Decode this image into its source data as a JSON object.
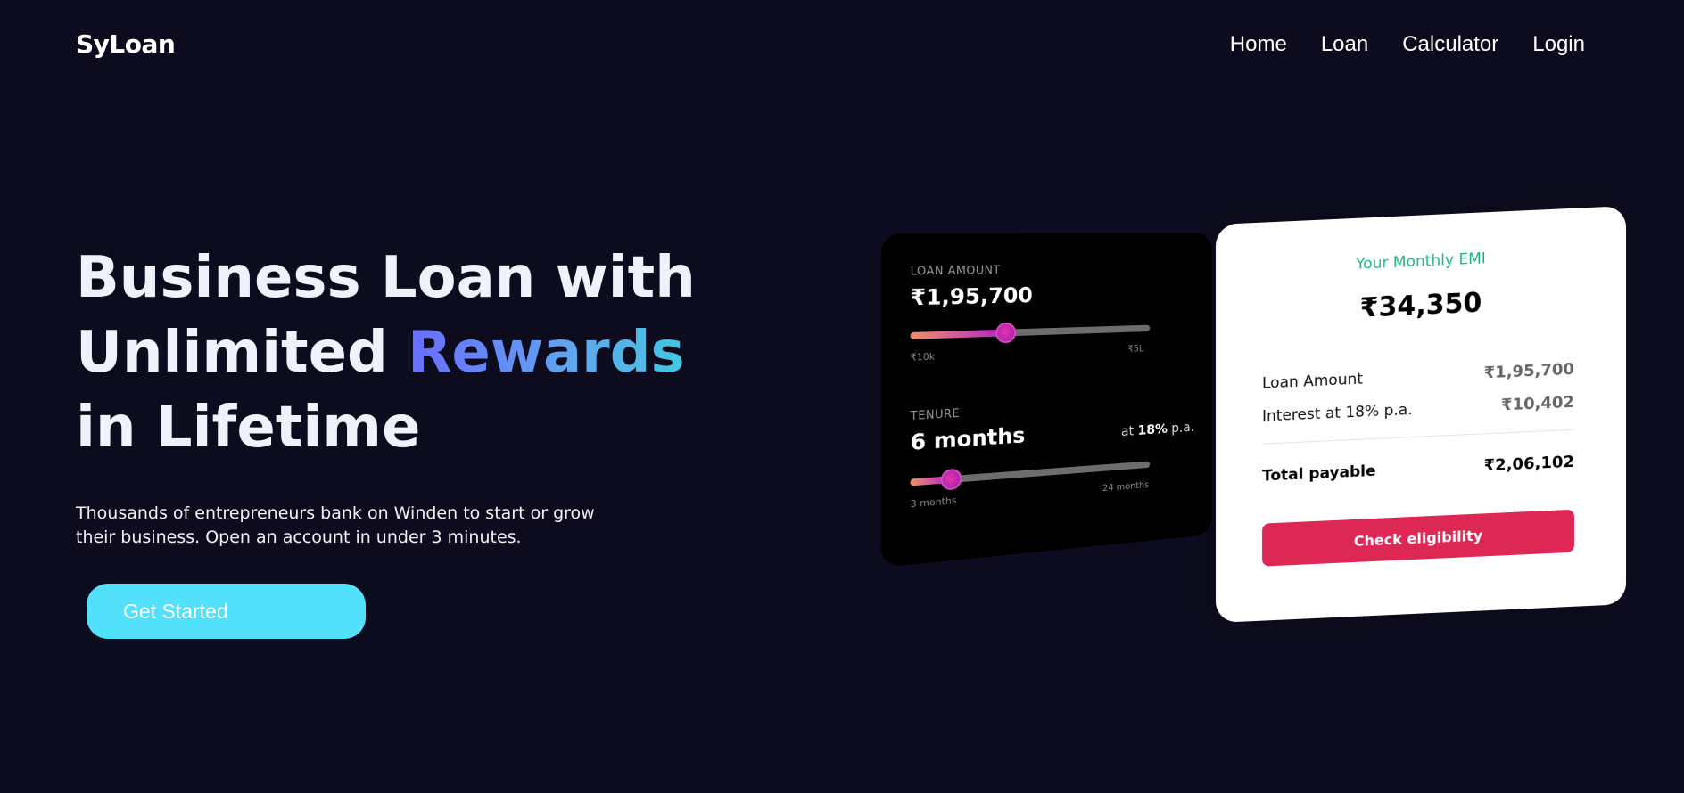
{
  "header": {
    "logo": "SyLoan",
    "nav": [
      "Home",
      "Loan",
      "Calculator",
      "Login"
    ]
  },
  "hero": {
    "title_part1": "Business Loan with Unlimited ",
    "title_highlight": "Rewards",
    "title_part2": " in Lifetime",
    "subtitle": "Thousands of entrepreneurs bank on Winden to start or grow their business. Open an account in under 3 minutes.",
    "cta_label": "Get Started"
  },
  "calculator": {
    "loan_amount_label": "LOAN AMOUNT",
    "loan_amount_value": "₹1,95,700",
    "loan_slider_fraction": 0.38,
    "loan_min": "₹10k",
    "loan_max": "₹5L",
    "tenure_label": "TENURE",
    "tenure_value": "6 months",
    "tenure_rate_prefix": "at ",
    "tenure_rate": "18%",
    "tenure_rate_suffix": " p.a.",
    "tenure_slider_fraction": 0.16,
    "tenure_min": "3 months",
    "tenure_max": "24 months"
  },
  "summary": {
    "emi_title": "Your Monthly EMI",
    "emi_value": "₹34,350",
    "loan_amount_label": "Loan Amount",
    "loan_amount_value": "₹1,95,700",
    "interest_label": "Interest at 18% p.a.",
    "interest_value": "₹10,402",
    "total_label": "Total payable",
    "total_value": "₹2,06,102",
    "eligibility_label": "Check eligibility"
  },
  "colors": {
    "background": "#0d0c1f",
    "cta": "#52e0fb",
    "accent_green": "#1cb57e",
    "eligibility": "#dd2754"
  }
}
